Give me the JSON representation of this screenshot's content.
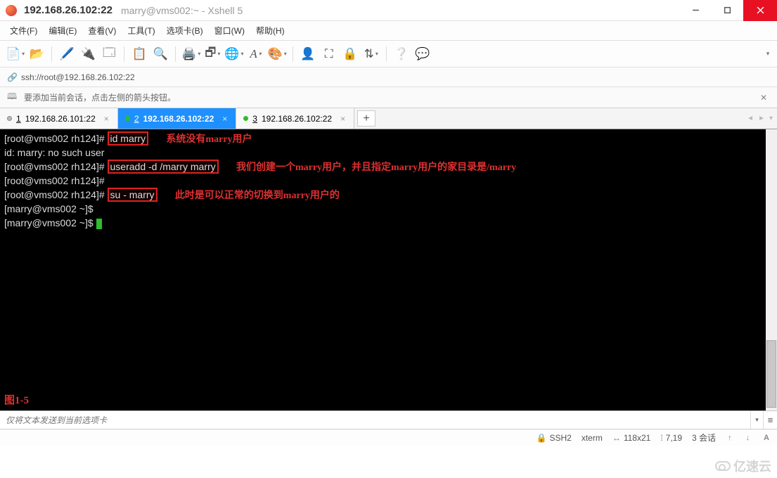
{
  "title": {
    "primary": "192.168.26.102:22",
    "secondary": "marry@vms002:~ - Xshell 5"
  },
  "menu": {
    "file": "文件(F)",
    "edit": "编辑(E)",
    "view": "查看(V)",
    "tools": "工具(T)",
    "tabs": "选项卡(B)",
    "window": "窗口(W)",
    "help": "帮助(H)"
  },
  "address": {
    "url": "ssh://root@192.168.26.102:22"
  },
  "info_bar": {
    "text": "要添加当前会话，点击左侧的箭头按钮。"
  },
  "tabs": [
    {
      "num": "1",
      "label": "192.168.26.101:22",
      "active": false,
      "dot": "gray"
    },
    {
      "num": "2",
      "label": "192.168.26.102:22",
      "active": true,
      "dot": "green"
    },
    {
      "num": "3",
      "label": "192.168.26.102:22",
      "active": false,
      "dot": "green"
    }
  ],
  "terminal": {
    "l1_prompt": "[root@vms002 rh124]# ",
    "l1_cmd": "id marry",
    "l1_annot": "系统没有marry用户",
    "l2": "id: marry: no such user",
    "l3_prompt": "[root@vms002 rh124]# ",
    "l3_cmd": "useradd -d /marry marry",
    "l3_annot": "我们创建一个marry用户，并且指定marry用户的家目录是/marry",
    "l4": "[root@vms002 rh124]#",
    "l5_prompt": "[root@vms002 rh124]# ",
    "l5_cmd": "su - marry",
    "l5_annot": "此时是可以正常的切换到marry用户的",
    "l6": "[marry@vms002 ~]$",
    "l7": "[marry@vms002 ~]$ ",
    "figure_label": "图1-5"
  },
  "send": {
    "placeholder": "仅将文本发送到当前选项卡"
  },
  "status": {
    "proto": "SSH2",
    "term": "xterm",
    "size": "118x21",
    "cursor": "7,19",
    "sessions": "3 会话"
  },
  "watermark": "亿速云"
}
